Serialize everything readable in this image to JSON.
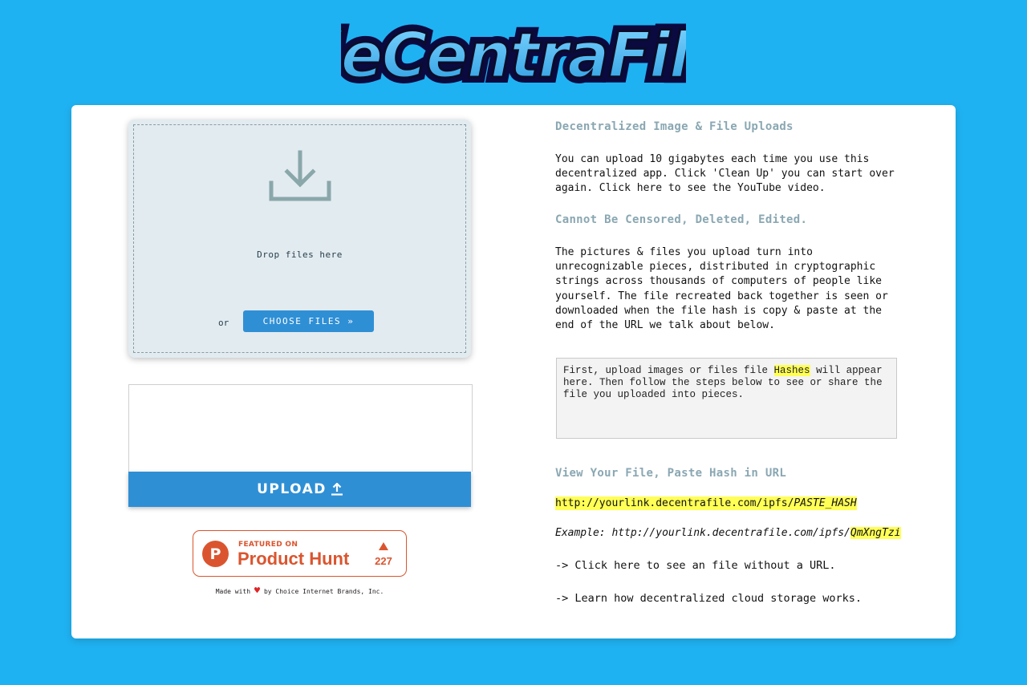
{
  "logo": {
    "text": "deCentraFile"
  },
  "dropzone": {
    "icon": "download-icon",
    "text": "Drop files here",
    "or_label": "or",
    "choose_label": "CHOOSE FILES »"
  },
  "upload": {
    "label": "UPLOAD",
    "icon": "upload-arrow-icon"
  },
  "product_hunt": {
    "logo_letter": "P",
    "featured": "FEATURED ON",
    "name": "Product Hunt",
    "count": "227"
  },
  "footer": {
    "made_with": "Made with",
    "by": "by Choice Internet Brands, Inc."
  },
  "content": {
    "heading1": "Decentralized Image & File Uploads",
    "para1": "You can upload 10 gigabytes each time you use this decentralized app. Click 'Clean Up' you can start over again. Click here to see the YouTube video.",
    "heading2": "Cannot Be Censored, Deleted, Edited.",
    "para2": "The pictures & files you upload turn into unrecognizable pieces, distributed in cryptographic strings across thousands of computers of people like yourself. The file recreated back together is seen or downloaded when the file hash is copy & paste at the end of the URL we talk about below.",
    "hashes_before": "First, upload images or files file ",
    "hashes_highlight": "Hashes",
    "hashes_after": " will appear here. Then follow the steps below to see or share the file you uploaded into pieces.",
    "heading3": "View Your File, Paste Hash in URL",
    "url_prefix": "http://yourlink.decentrafile.com/ipfs/",
    "url_hash": "PASTE_HASH",
    "example_label": "Example: ",
    "example_prefix": "http://yourlink.decentrafile.com/ipfs/",
    "example_hash": "QmXngTzi",
    "link1": "-> Click here to see an file without a URL.",
    "link2": "-> Learn how decentralized cloud storage works."
  },
  "colors": {
    "background": "#1fb2f2",
    "accent_blue": "#2f8fd5",
    "heading_gray": "#8aa7b2",
    "product_hunt": "#da552f",
    "highlight": "#ffff55"
  }
}
